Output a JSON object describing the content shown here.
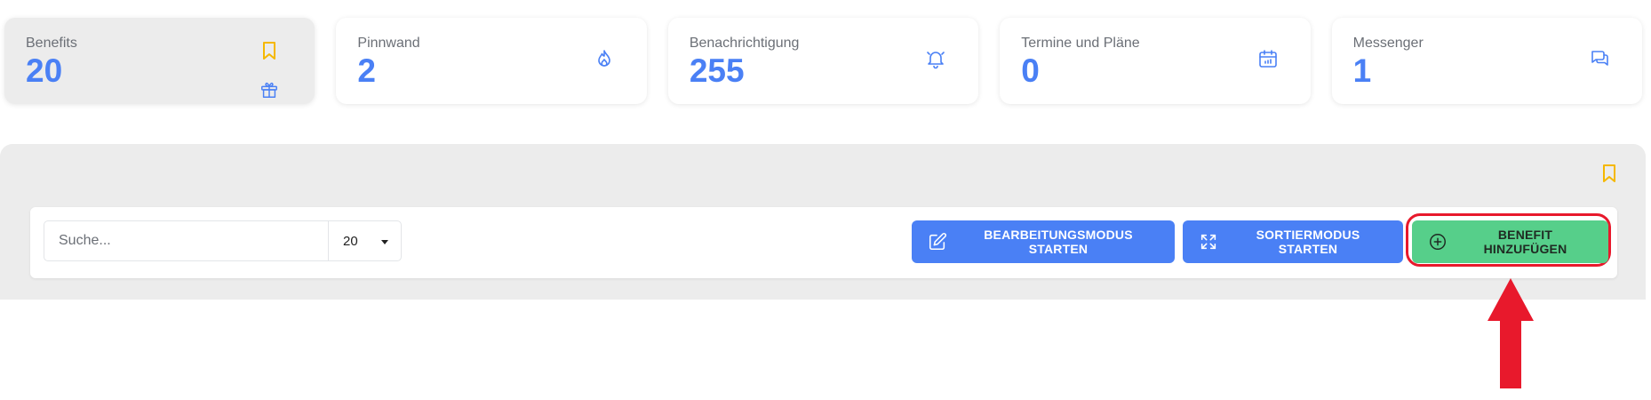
{
  "stats": [
    {
      "label": "Benefits",
      "value": "20",
      "icon": "gift-icon"
    },
    {
      "label": "Pinnwand",
      "value": "2",
      "icon": "fire-icon"
    },
    {
      "label": "Benachrichtigung",
      "value": "255",
      "icon": "bell-icon"
    },
    {
      "label": "Termine und Pläne",
      "value": "0",
      "icon": "calendar-icon"
    },
    {
      "label": "Messenger",
      "value": "1",
      "icon": "chat-icon"
    }
  ],
  "toolbar": {
    "search_placeholder": "Suche...",
    "page_size": "20",
    "edit_mode_label": "BEARBEITUNGSMODUS STARTEN",
    "sort_mode_label": "SORTIERMODUS STARTEN",
    "add_benefit_label": "BENEFIT HINZUFÜGEN"
  },
  "colors": {
    "accent_blue": "#4a80f5",
    "add_green": "#56cf8a",
    "bookmark_yellow": "#f5b800",
    "highlight_red": "#e8192c"
  }
}
